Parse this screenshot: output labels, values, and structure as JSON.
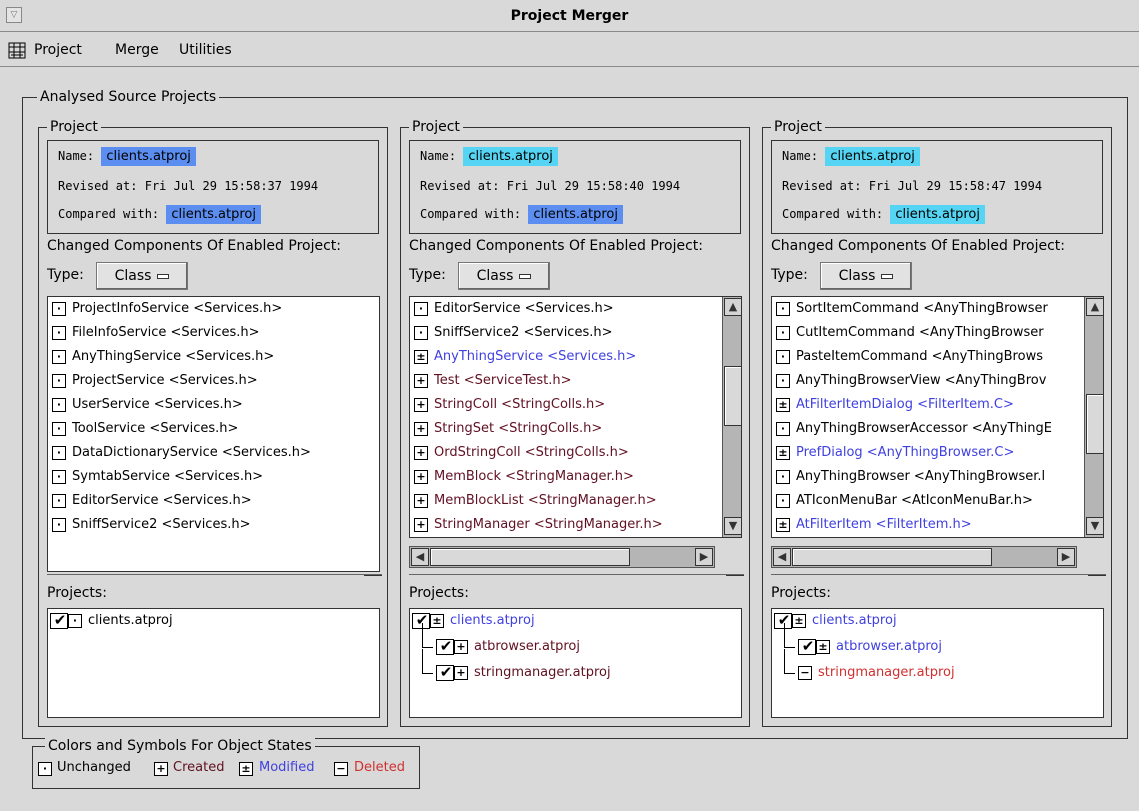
{
  "window": {
    "title": "Project Merger",
    "menu_glyph": "▽"
  },
  "menubar": {
    "icon": "project-merger-app-icon",
    "items": [
      "Project",
      "Merge",
      "Utilities"
    ]
  },
  "main_group": {
    "title": "Analysed Source Projects"
  },
  "colors": {
    "highlight_blue": "#5b8ef0",
    "highlight_cyan": "#55d5f3",
    "modified_text": "#4040e0",
    "deleted_text": "#d03030",
    "created_text": "#601020"
  },
  "panels": [
    {
      "group_title": "Project",
      "name_label": "Name:",
      "name_value": "clients.atproj",
      "revised_label": "Revised at:",
      "revised_value": "Fri Jul 29 15:58:37 1994",
      "compared_label": "Compared with:",
      "compared_value": "clients.atproj",
      "changed_label": "Changed Components Of Enabled Project:",
      "type_label": "Type:",
      "type_value": "Class",
      "components": [
        {
          "state": "unchanged",
          "text": "ProjectInfoService <Services.h>"
        },
        {
          "state": "unchanged",
          "text": "FileInfoService <Services.h>"
        },
        {
          "state": "unchanged",
          "text": "AnyThingService <Services.h>"
        },
        {
          "state": "unchanged",
          "text": "ProjectService <Services.h>"
        },
        {
          "state": "unchanged",
          "text": "UserService <Services.h>"
        },
        {
          "state": "unchanged",
          "text": "ToolService <Services.h>"
        },
        {
          "state": "unchanged",
          "text": "DataDictionaryService <Services.h>"
        },
        {
          "state": "unchanged",
          "text": "SymtabService <Services.h>"
        },
        {
          "state": "unchanged",
          "text": "EditorService <Services.h>"
        },
        {
          "state": "unchanged",
          "text": "SniffService2 <Services.h>"
        }
      ],
      "projects_label": "Projects:",
      "projects": [
        {
          "state": "unchanged",
          "checked": true,
          "text": "clients.atproj",
          "level": 0
        }
      ]
    },
    {
      "group_title": "Project",
      "name_label": "Name:",
      "name_value": "clients.atproj",
      "revised_label": "Revised at:",
      "revised_value": "Fri Jul 29 15:58:40 1994",
      "compared_label": "Compared with:",
      "compared_value": "clients.atproj",
      "changed_label": "Changed Components Of Enabled Project:",
      "type_label": "Type:",
      "type_value": "Class",
      "components": [
        {
          "state": "unchanged",
          "text": "EditorService <Services.h>"
        },
        {
          "state": "unchanged",
          "text": "SniffService2 <Services.h>"
        },
        {
          "state": "modified",
          "text": "AnyThingService <Services.h>"
        },
        {
          "state": "created",
          "text": "Test <ServiceTest.h>"
        },
        {
          "state": "created",
          "text": "StringColl <StringColls.h>"
        },
        {
          "state": "created",
          "text": "StringSet <StringColls.h>"
        },
        {
          "state": "created",
          "text": "OrdStringColl <StringColls.h>"
        },
        {
          "state": "created",
          "text": "MemBlock <StringManager.h>"
        },
        {
          "state": "created",
          "text": "MemBlockList <StringManager.h>"
        },
        {
          "state": "created",
          "text": "StringManager <StringManager.h>"
        }
      ],
      "projects_label": "Projects:",
      "projects": [
        {
          "state": "modified",
          "checked": true,
          "text": "clients.atproj",
          "level": 0
        },
        {
          "state": "created",
          "checked": true,
          "text": "atbrowser.atproj",
          "level": 1
        },
        {
          "state": "created",
          "checked": true,
          "text": "stringmanager.atproj",
          "level": 1
        }
      ]
    },
    {
      "group_title": "Project",
      "name_label": "Name:",
      "name_value": "clients.atproj",
      "revised_label": "Revised at:",
      "revised_value": "Fri Jul 29 15:58:47 1994",
      "compared_label": "Compared with:",
      "compared_value": "clients.atproj",
      "changed_label": "Changed Components Of Enabled Project:",
      "type_label": "Type:",
      "type_value": "Class",
      "components": [
        {
          "state": "unchanged",
          "text": "SortItemCommand <AnyThingBrowser"
        },
        {
          "state": "unchanged",
          "text": "CutItemCommand <AnyThingBrowser"
        },
        {
          "state": "unchanged",
          "text": "PasteItemCommand <AnyThingBrows"
        },
        {
          "state": "unchanged",
          "text": "AnyThingBrowserView <AnyThingBrov"
        },
        {
          "state": "modified",
          "text": "AtFilterItemDialog <FilterItem.C>"
        },
        {
          "state": "unchanged",
          "text": "AnyThingBrowserAccessor <AnyThingE"
        },
        {
          "state": "modified",
          "text": "PrefDialog <AnyThingBrowser.C>"
        },
        {
          "state": "unchanged",
          "text": "AnyThingBrowser <AnyThingBrowser.l"
        },
        {
          "state": "unchanged",
          "text": "ATIconMenuBar <AtIconMenuBar.h>"
        },
        {
          "state": "modified",
          "text": "AtFilterItem <FilterItem.h>"
        }
      ],
      "projects_label": "Projects:",
      "projects": [
        {
          "state": "modified",
          "checked": true,
          "text": "clients.atproj",
          "level": 0
        },
        {
          "state": "modified",
          "checked": true,
          "text": "atbrowser.atproj",
          "level": 1
        },
        {
          "state": "deleted",
          "checked": false,
          "text": "stringmanager.atproj",
          "level": 1
        }
      ]
    }
  ],
  "legend": {
    "title": "Colors and Symbols For Object States",
    "unchanged": "Unchanged",
    "created": "Created",
    "modified": "Modified",
    "deleted": "Deleted"
  },
  "scroll": {
    "panel2_vertical_position": 0.35,
    "panel3_vertical_position": 0.55
  }
}
